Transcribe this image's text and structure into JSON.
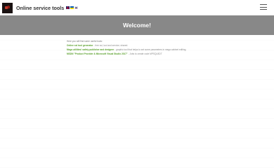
{
  "header": {
    "brand": "Online service tools",
    "flags": [
      "flag-uk",
      "flag-ua",
      "flag-ru"
    ],
    "menu_icon": "hamburger-icon"
  },
  "hero": {
    "title": "Welcome!"
  },
  "content": {
    "intro": "Here you will find some useful tools:",
    "links": [
      {
        "label": "Online ssl tool generator",
        "desc": " - free ssl, tool and service; shared."
      },
      {
        "label": "Mega utilities! safety publisher and designer",
        "desc": " - graphic tool that helps to set some parameters in mega cabinet editing."
      },
      {
        "label": "MSDN \"Product Provider & Microsoft Visual Studio 2017\"",
        "desc": " - Jobs to create code MPSQLBDT"
      }
    ]
  },
  "colors": {
    "hero_bg": "#888888",
    "link": "#5aa02c",
    "page_bg": "#ffffff"
  }
}
